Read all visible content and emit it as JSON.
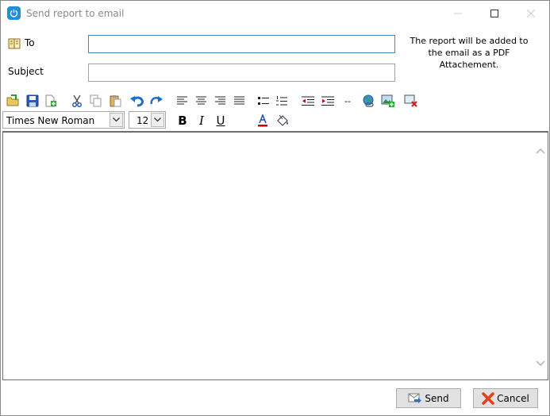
{
  "window": {
    "title": "Send report to email"
  },
  "form": {
    "to_label": "To",
    "to_value": "",
    "subject_label": "Subject",
    "subject_value": "",
    "note": "The report will be added to the email as a PDF Attachement."
  },
  "toolbar": {
    "font_family": "Times New Roman",
    "font_size": "12",
    "bold": "B",
    "italic": "I",
    "underline": "U",
    "horizontal_rule": "--",
    "font_color": "#cc0000"
  },
  "editor": {
    "content": ""
  },
  "buttons": {
    "send": "Send",
    "cancel": "Cancel"
  },
  "colors": {
    "accent": "#1f8fd6",
    "focus_border": "#3c8cb8",
    "button_face": "#e1e1e1"
  }
}
